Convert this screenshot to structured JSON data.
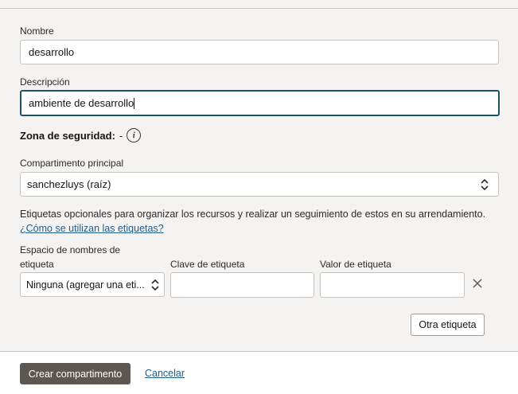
{
  "form": {
    "name": {
      "label": "Nombre",
      "value": "desarrollo"
    },
    "description": {
      "label": "Descripción",
      "value": "ambiente de desarrollo"
    },
    "security_zone": {
      "label": "Zona de seguridad:",
      "value": "-"
    },
    "parent_compartment": {
      "label": "Compartimento principal",
      "selected": "sanchezluys (raíz)"
    },
    "tags": {
      "description": "Etiquetas opcionales para organizar los recursos y realizar un seguimiento de estos en su arrendamiento.",
      "help_link": "¿Cómo se utilizan las etiquetas?",
      "namespace_label_line1": "Espacio de nombres de",
      "namespace_label_line2": "etiqueta",
      "namespace_selected": "Ninguna (agregar una eti...",
      "key_label": "Clave de etiqueta",
      "key_value": "",
      "value_label": "Valor de etiqueta",
      "value_value": "",
      "add_tag_button": "Otra etiqueta"
    }
  },
  "footer": {
    "create_button": "Crear compartimento",
    "cancel_link": "Cancelar"
  },
  "colors": {
    "primary_button": "#5c5753",
    "link": "#1f5c8f",
    "focus_border": "#1b5366",
    "background": "#f4f3f1"
  },
  "icons": {
    "info": "info-icon",
    "select_chevron": "chevron-up-down-icon",
    "remove": "close-icon"
  }
}
